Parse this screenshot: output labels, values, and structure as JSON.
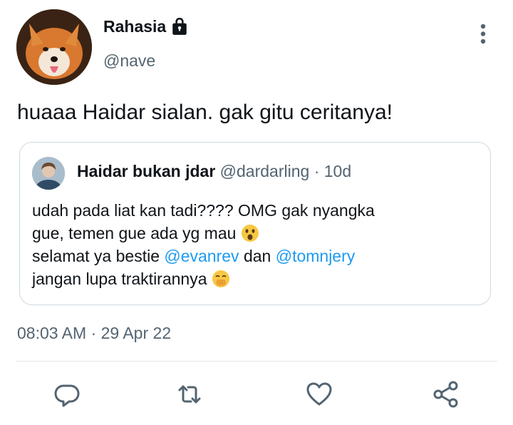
{
  "author": {
    "display_name": "Rahasia",
    "handle": "@nave",
    "protected_icon": "lock-icon",
    "avatar": "fox-avatar"
  },
  "tweet": {
    "text": "huaaa Haidar sialan. gak gitu ceritanya!",
    "time": "08:03 AM",
    "separator": "·",
    "date": "29 Apr 22"
  },
  "quote": {
    "display_name": "Haidar bukan jdar",
    "handle": "@dardarling",
    "separator": "·",
    "time": "10d",
    "line1": "udah pada liat kan tadi???? OMG gak nyangka",
    "line2": "gue, temen gue ada yg mau",
    "line3_prefix": "selamat ya bestie",
    "mention1": "@evanrev",
    "line3_mid": "dan",
    "mention2": "@tomnjery",
    "line4": "jangan lupa traktirannya",
    "emoji1": "astonished-face",
    "emoji2": "face-with-hand-over-mouth"
  },
  "actions": [
    "reply-icon",
    "retweet-icon",
    "like-icon",
    "share-icon"
  ],
  "colors": {
    "text": "#0f1419",
    "secondary": "#536471",
    "mention": "#1d9bf0",
    "border": "#cfd9de"
  }
}
